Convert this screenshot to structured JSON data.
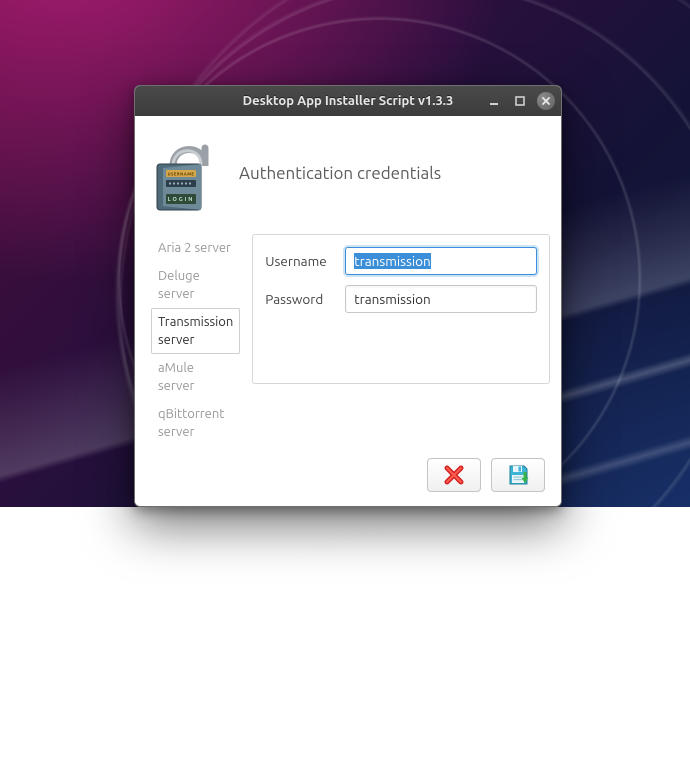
{
  "window": {
    "title": "Desktop App Installer Script v1.3.3"
  },
  "header": {
    "title": "Authentication credentials"
  },
  "servers": {
    "items": [
      {
        "label": "Aria 2 server",
        "active": false
      },
      {
        "label": "Deluge server",
        "active": false
      },
      {
        "label": "Transmission server",
        "active": true
      },
      {
        "label": "aMule server",
        "active": false
      },
      {
        "label": "qBittorrent server",
        "active": false
      }
    ]
  },
  "form": {
    "username_label": "Username",
    "username_value": "transmission",
    "password_label": "Password",
    "password_value": "transmission"
  },
  "icons": {
    "lock": "lock-icon",
    "minimize": "minimize-icon",
    "maximize": "maximize-icon",
    "close": "close-icon",
    "cancel": "cancel-x-icon",
    "save": "floppy-save-icon"
  },
  "colors": {
    "selection": "#3b8ed8",
    "cancel": "#d11f1f",
    "save_primary": "#3fb5d6",
    "save_accent": "#37b34a"
  }
}
